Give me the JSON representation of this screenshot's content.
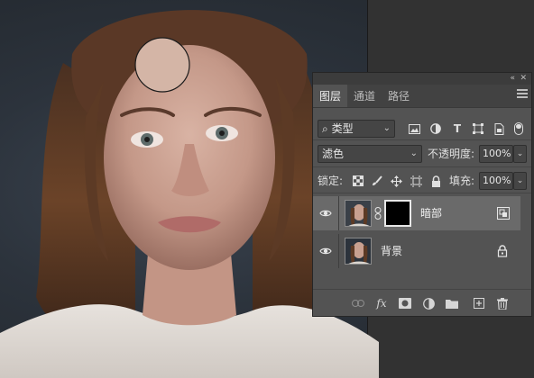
{
  "panel": {
    "tabs": [
      {
        "label": "图层"
      },
      {
        "label": "通道"
      },
      {
        "label": "路径"
      }
    ],
    "filter": {
      "kind": "类型"
    },
    "blend_mode": "滤色",
    "opacity": {
      "label": "不透明度:",
      "value": "100%"
    },
    "lock": {
      "label": "锁定:"
    },
    "fill": {
      "label": "填充:",
      "value": "100%"
    },
    "layers": [
      {
        "name": "暗部",
        "selected": true
      },
      {
        "name": "背景",
        "selected": false
      }
    ]
  },
  "colors": {
    "panel_bg": "#535353",
    "selected_row": "#6a6a6a",
    "tab_bar": "#424242"
  }
}
